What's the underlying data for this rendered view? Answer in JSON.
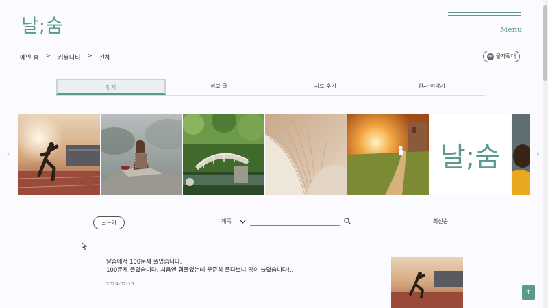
{
  "header": {
    "logo": "날;숨",
    "menu_label": "Menu"
  },
  "breadcrumb": {
    "items": [
      "메인 홈",
      "커뮤니티",
      "전체"
    ],
    "separator": ">"
  },
  "zoom_button": {
    "label": "글자확대"
  },
  "tabs": [
    {
      "label": "전체",
      "active": true
    },
    {
      "label": "정보 글",
      "active": false
    },
    {
      "label": "치료 후기",
      "active": false
    },
    {
      "label": "환자 이야기",
      "active": false
    }
  ],
  "carousel": {
    "slides": [
      "runner-track-photo",
      "woman-on-rock-photo",
      "bridge-forest-photo",
      "open-book-photo",
      "sunset-road-photo",
      "logo-tile",
      "portrait-photo"
    ],
    "logo_text": "날;숨"
  },
  "toolbar": {
    "write_label": "글쓰기",
    "search_field_label": "제목",
    "search_value": "",
    "sort_label": "최신순"
  },
  "posts": [
    {
      "title": "날숨에서 100문제 풀었습니다.",
      "excerpt": "100문제 풀었습니다. 처음엔 힘들었는데 꾸준히 풀다보니 많이 늘었습니다!..",
      "date": "2024-02-15"
    }
  ],
  "top_button": {
    "label": "↑"
  },
  "colors": {
    "accent": "#5a9a8e",
    "background": "#fbfaff"
  }
}
